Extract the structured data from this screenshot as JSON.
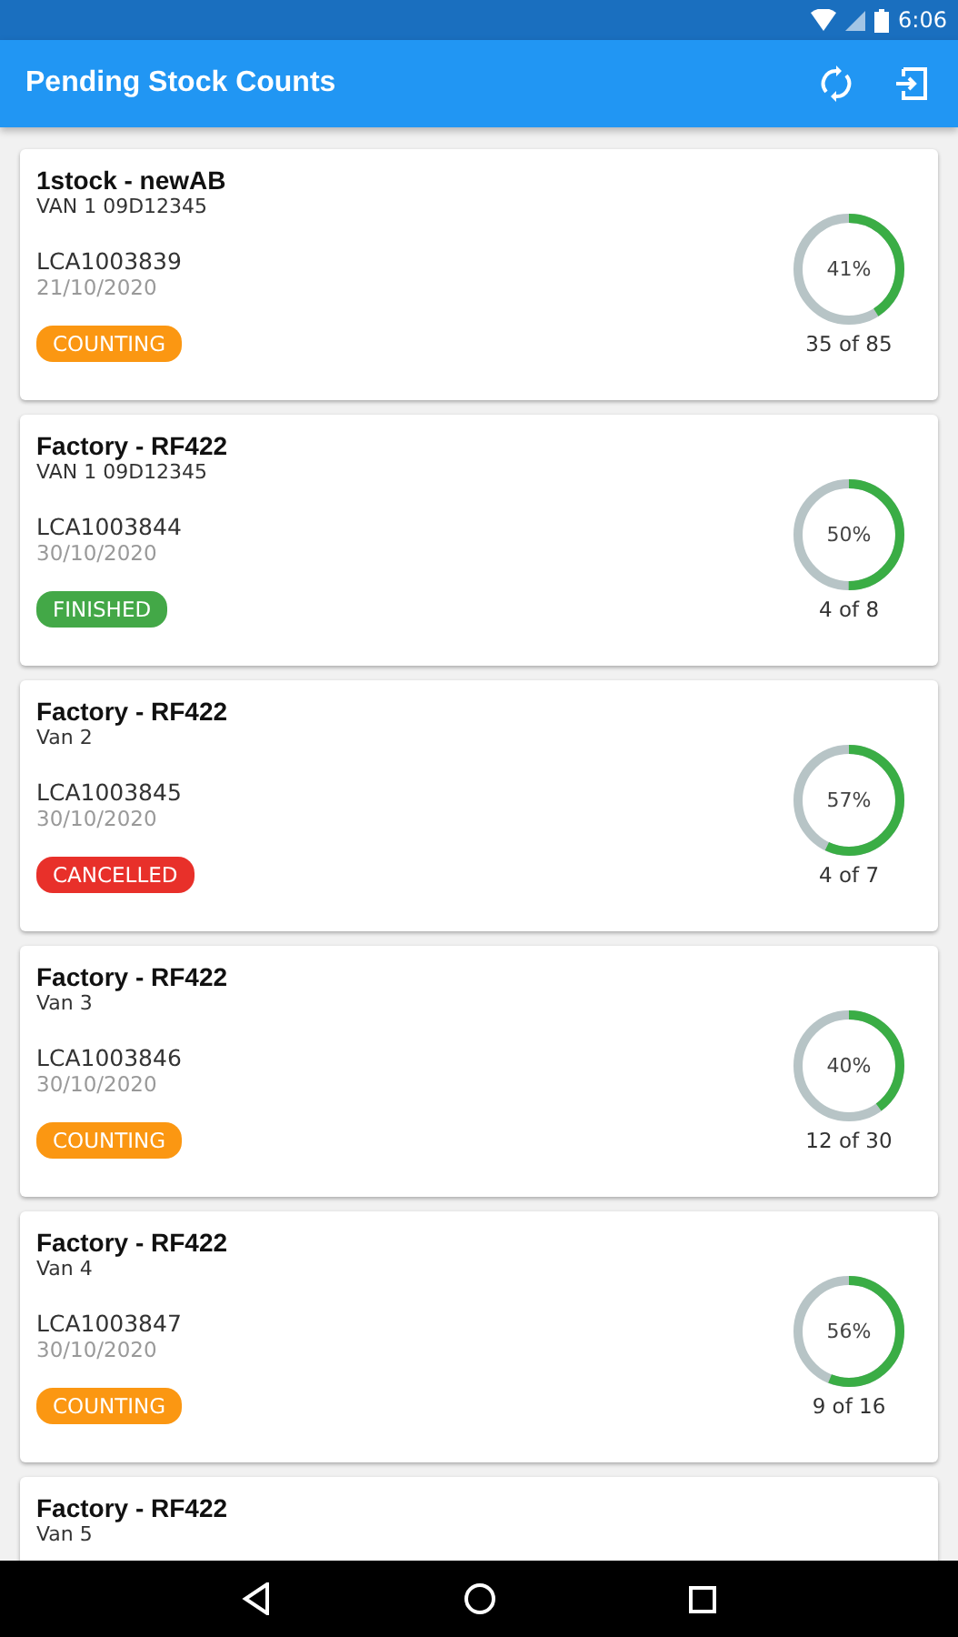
{
  "status_bar": {
    "time": "6:06"
  },
  "app_bar": {
    "title": "Pending Stock Counts"
  },
  "counts": [
    {
      "title": "1stock - newAB",
      "vehicle": "VAN 1 09D12345",
      "reference": "LCA1003839",
      "date": "21/10/2020",
      "status": "COUNTING",
      "kind": "counting",
      "level": 0.41,
      "percent": "41%",
      "progress": "35 of 85"
    },
    {
      "title": "Factory - RF422",
      "vehicle": "VAN 1 09D12345",
      "reference": "LCA1003844",
      "date": "30/10/2020",
      "status": "FINISHED",
      "kind": "finished",
      "level": 0.5,
      "percent": "50%",
      "progress": "4 of 8"
    },
    {
      "title": "Factory - RF422",
      "vehicle": "Van 2",
      "reference": "LCA1003845",
      "date": "30/10/2020",
      "status": "CANCELLED",
      "kind": "cancelled",
      "level": 0.57,
      "percent": "57%",
      "progress": "4 of 7"
    },
    {
      "title": "Factory - RF422",
      "vehicle": "Van 3",
      "reference": "LCA1003846",
      "date": "30/10/2020",
      "status": "COUNTING",
      "kind": "counting",
      "level": 0.4,
      "percent": "40%",
      "progress": "12 of 30"
    },
    {
      "title": "Factory - RF422",
      "vehicle": "Van 4",
      "reference": "LCA1003847",
      "date": "30/10/2020",
      "status": "COUNTING",
      "kind": "counting",
      "level": 0.56,
      "percent": "56%",
      "progress": "9 of 16"
    },
    {
      "title": "Factory - RF422",
      "vehicle": "Van 5"
    }
  ]
}
